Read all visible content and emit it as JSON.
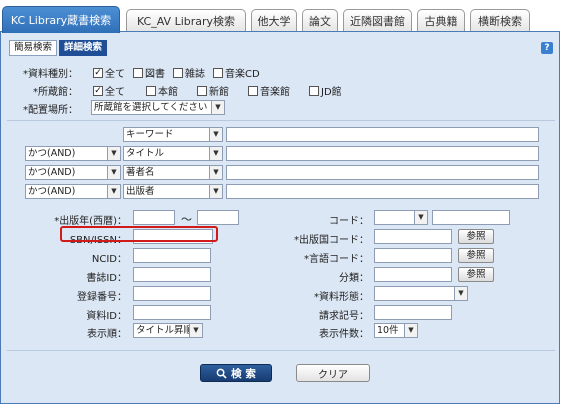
{
  "tabs": [
    "KC Library蔵書検索",
    "KC_AV Library検索",
    "他大学",
    "論文",
    "近隣図書館",
    "古典籍",
    "横断検索"
  ],
  "subtabs": [
    "簡易検索",
    "詳細検索"
  ],
  "help_label": "?",
  "material_type": {
    "label": "*資料種別：",
    "options": [
      {
        "label": "全て",
        "checked": true
      },
      {
        "label": "図書",
        "checked": false
      },
      {
        "label": "雑誌",
        "checked": false
      },
      {
        "label": "音楽CD",
        "checked": false
      }
    ]
  },
  "holding_library": {
    "label": "*所蔵館：",
    "options": [
      {
        "label": "全て",
        "checked": true
      },
      {
        "label": "本館",
        "checked": false
      },
      {
        "label": "新館",
        "checked": false
      },
      {
        "label": "音楽館",
        "checked": false
      },
      {
        "label": "JD館",
        "checked": false
      }
    ]
  },
  "location": {
    "label": "*配置場所：",
    "value": "所蔵館を選択してください"
  },
  "keyword_rows": [
    {
      "operator": "",
      "field": "キーワード",
      "value": ""
    },
    {
      "operator": "かつ(AND)",
      "field": "タイトル",
      "value": ""
    },
    {
      "operator": "かつ(AND)",
      "field": "著者名",
      "value": ""
    },
    {
      "operator": "かつ(AND)",
      "field": "出版者",
      "value": ""
    }
  ],
  "left_fields": {
    "pub_year": "*出版年(西暦)：",
    "pub_year_sep": "〜",
    "isbn": "SBN/ISSN：",
    "ncid": "NCID：",
    "shoshi_id": "書誌ID：",
    "reg_no": "登録番号：",
    "material_id": "資料ID：",
    "sort": "表示順：",
    "sort_value": "タイトル昇順"
  },
  "right_fields": {
    "code": "コード：",
    "pub_country": "*出版国コード：",
    "lang": "*言語コード：",
    "class": "分類：",
    "material_form": "*資料形態：",
    "call_no": "請求記号：",
    "count": "表示件数：",
    "count_value": "10件",
    "ref_label": "参照"
  },
  "buttons": {
    "search": "検 索",
    "clear": "クリア"
  }
}
